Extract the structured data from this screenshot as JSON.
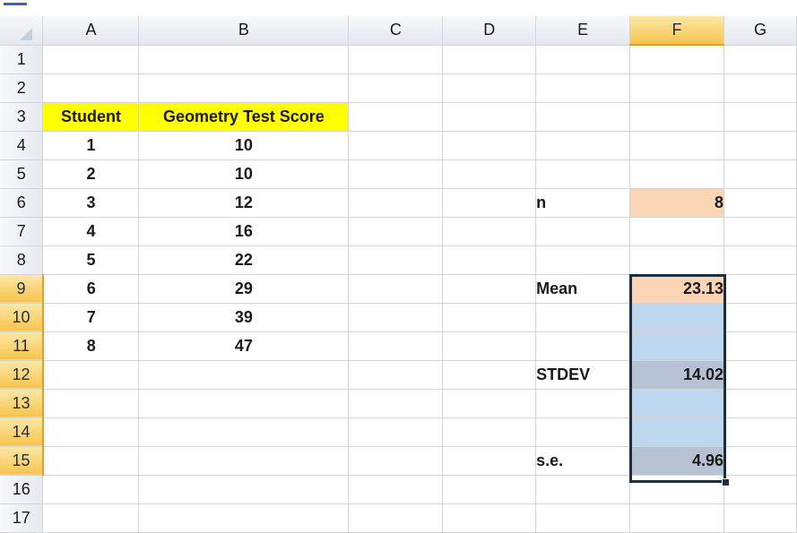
{
  "colors": {
    "header_yellow": "#ffff00",
    "peach": "#fcd5b4",
    "selection_blue": "#bdd7ee",
    "selection_gray": "#b7c3d3",
    "selected_header": "#f7c34c"
  },
  "column_headers": [
    "A",
    "B",
    "C",
    "D",
    "E",
    "F",
    "G"
  ],
  "row_headers": [
    "1",
    "2",
    "3",
    "4",
    "5",
    "6",
    "7",
    "8",
    "9",
    "10",
    "11",
    "12",
    "13",
    "14",
    "15",
    "16",
    "17"
  ],
  "selected_column": "F",
  "selected_rows": [
    "9",
    "10",
    "11",
    "12",
    "13",
    "14",
    "15"
  ],
  "cells": {
    "A3": "Student",
    "B3": "Geometry Test Score",
    "A4": "1",
    "B4": "10",
    "A5": "2",
    "B5": "10",
    "A6": "3",
    "B6": "12",
    "A7": "4",
    "B7": "16",
    "A8": "5",
    "B8": "22",
    "A9": "6",
    "B9": "29",
    "A10": "7",
    "B10": "39",
    "A11": "8",
    "B11": "47",
    "E6": "n",
    "F6": "8",
    "E9": "Mean",
    "F9": "23.13",
    "E12": "STDEV",
    "F12": "14.02",
    "E15": "s.e.",
    "F15": "4.96"
  }
}
